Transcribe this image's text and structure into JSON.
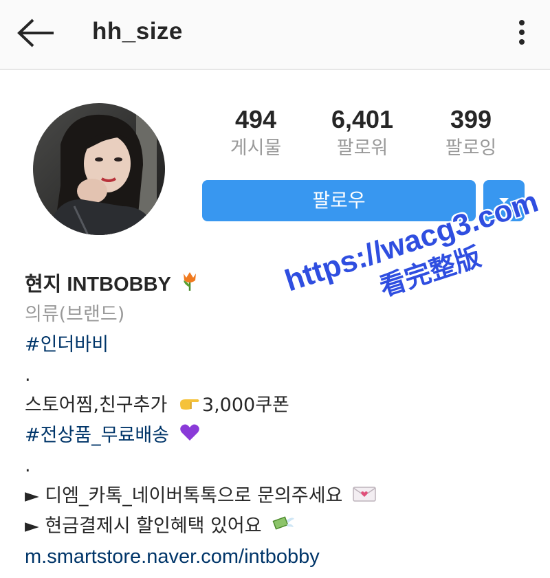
{
  "header": {
    "username": "hh_size",
    "back_icon": "arrow-left-icon",
    "more_icon": "more-vertical-icon"
  },
  "stats": [
    {
      "value": "494",
      "label": "게시물"
    },
    {
      "value": "6,401",
      "label": "팔로워"
    },
    {
      "value": "399",
      "label": "팔로잉"
    }
  ],
  "actions": {
    "follow_label": "팔로우",
    "dropdown_icon": "caret-down-icon"
  },
  "bio": {
    "name": "현지  INTBOBBY",
    "category": "의류(브랜드)",
    "hashtag1": "#인더바비",
    "dot1": ".",
    "line_store": "스토어찜,친구추가",
    "line_coupon": "3,000쿠폰",
    "hashtag2": "#전상품_무료배송",
    "dot2": ".",
    "line_inquiry": "► 디엠_카톡_네이버톡톡으로 문의주세요",
    "line_discount": "► 현금결제시 할인혜택 있어요",
    "link": "m.smartstore.naver.com/intbobby"
  },
  "watermark": {
    "url": "https://wacg3.com",
    "caption": "看完整版"
  },
  "colors": {
    "accent": "#3897f0",
    "link": "#003569",
    "muted": "#999999",
    "watermark": "#2f4ee0"
  }
}
